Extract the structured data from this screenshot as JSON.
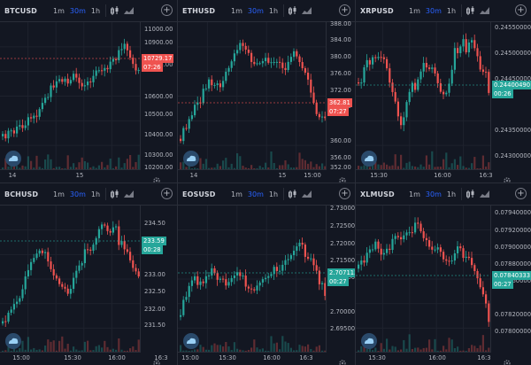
{
  "timeframes": [
    "1m",
    "30m",
    "1h"
  ],
  "active_timeframe": "30m",
  "colors": {
    "up": "#26a69a",
    "down": "#ef5350",
    "bg": "#131722",
    "accent": "#2962ff"
  },
  "icons": [
    "candles-icon",
    "area-chart-icon",
    "add-chart-icon",
    "settings-icon",
    "tradingview-logo-icon"
  ],
  "panels": [
    {
      "symbol": "BTCUSD",
      "ticks": [
        "11000.00",
        "10900.00",
        "10800.00",
        "10600.00",
        "10500.00",
        "10400.00",
        "10300.00",
        "10200.00"
      ],
      "price_label": {
        "value": "10729.17",
        "time": "07:26",
        "color": "#ef5350"
      },
      "xticks": [
        "14",
        "15"
      ]
    },
    {
      "symbol": "ETHUSD",
      "ticks": [
        "388.00",
        "384.00",
        "380.00",
        "376.00",
        "372.00",
        "368.00",
        "360.00",
        "356.00",
        "352.00"
      ],
      "price_label": {
        "value": "362.81",
        "time": "07:27",
        "color": "#ef5350"
      },
      "xticks": [
        "14",
        "15",
        "15:00"
      ]
    },
    {
      "symbol": "XRPUSD",
      "ticks": [
        "0.24550000",
        "0.24500000",
        "0.24450000",
        "0.24350000",
        "0.24300000"
      ],
      "price_label": {
        "value": "0.24400490",
        "time": "00:26",
        "color": "#26a69a"
      },
      "xticks": [
        "15:30",
        "16:00",
        "16:3"
      ]
    },
    {
      "symbol": "BCHUSD",
      "ticks": [
        "234.50",
        "234.00",
        "233.00",
        "232.50",
        "232.00",
        "231.50"
      ],
      "price_label": {
        "value": "233.59",
        "time": "00:28",
        "color": "#26a69a"
      },
      "xticks": [
        "15:00",
        "15:30",
        "16:00",
        "16:3"
      ]
    },
    {
      "symbol": "EOSUSD",
      "ticks": [
        "2.7300000",
        "2.7250000",
        "2.7200000",
        "2.7150000",
        "2.7100000",
        "2.7000000",
        "2.6950000"
      ],
      "price_label": {
        "value": "2.7071137",
        "time": "00:27",
        "color": "#26a69a"
      },
      "xticks": [
        "15:00",
        "15:30",
        "16:00",
        "16:3"
      ]
    },
    {
      "symbol": "XLMUSD",
      "ticks": [
        "0.07940000",
        "0.07920000",
        "0.07900000",
        "0.07880000",
        "0.07860000",
        "0.07820000",
        "0.07800000"
      ],
      "price_label": {
        "value": "0.07840333",
        "time": "00:27",
        "color": "#26a69a"
      },
      "xticks": [
        "15:30",
        "16:00",
        "16:3"
      ]
    }
  ]
}
